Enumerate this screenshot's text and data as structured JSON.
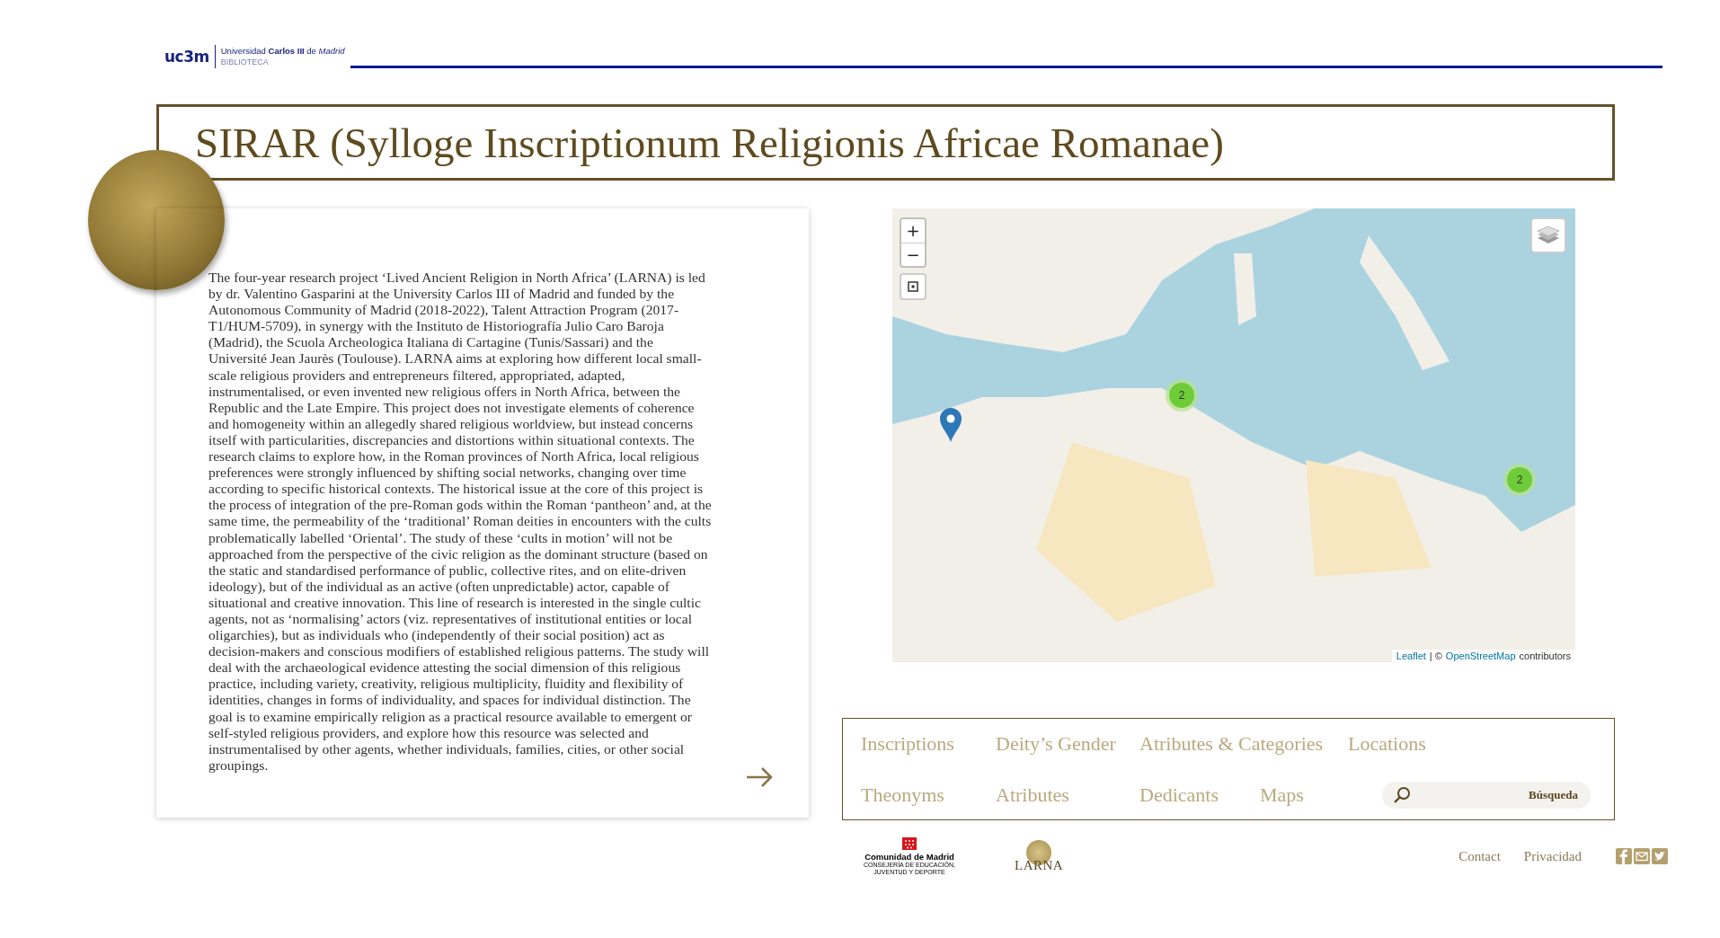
{
  "header": {
    "logo": {
      "wordmark": "uc3m",
      "university": "Universidad **Carlos III** de *Madrid*",
      "unit": "BIBLIOTECA"
    }
  },
  "title": "SIRAR (Sylloge Inscriptionum Religionis Africae Romanae)",
  "intro": {
    "text": "The four-year research project ‘Lived Ancient Religion in North Africa’ (LARNA) is led by dr. Valentino Gasparini at the University Carlos III of Madrid and funded by the Autonomous Community of Madrid (2018-2022), Talent Attraction Program (2017-T1/HUM-5709), in synergy with the Instituto de Historiografía Julio Caro Baroja (Madrid), the Scuola Archeologica Italiana di Cartagine (Tunis/Sassari) and the Université Jean Jaurès (Toulouse). LARNA aims at exploring how different local small-scale religious providers and entrepreneurs filtered, appropriated, adapted, instrumentalised, or even invented new religious offers in North Africa, between the Republic and the Late Empire. This project does not investigate elements of coherence and homogeneity within an allegedly shared religious worldview, but instead concerns itself with particularities, discrepancies and distortions within situational contexts. The research claims to explore how, in the Roman provinces of North Africa, local religious preferences were strongly influenced by shifting social networks, changing over time according to specific historical contexts. The historical issue at the core of this project is the process of integration of the pre-Roman gods within the Roman ‘pantheon’ and, at the same time, the permeability of the ‘traditional’ Roman deities in encounters with the cults problematically labelled ‘Oriental’. The study of these ‘cults in motion’ will not be approached from the perspective of the civic religion as the dominant structure (based on the static and standardised performance of public, collective rites, and on elite-driven ideology), but of the individual as an active (often unpredictable) actor, capable of situational and creative innovation. This line of research is interested in the single cultic agents, not as ‘normalising’ actors (viz. representatives of institutional entities or local oligarchies), but as individuals who (independently of their social position) act as decision-makers and conscious modifiers of established religious patterns. The study will deal with the archaeological evidence attesting the social dimension of this religious practice, including variety, creativity, religious multiplicity, fluidity and flexibility of identities, changes in forms of individuality, and spaces for individual distinction. The goal is to examine empirically religion as a practical resource available to emergent or self-styled religious providers, and explore how this resource was selected and instrumentalised by other agents, whether individuals, families, cities, or other social groupings."
  },
  "map": {
    "zoom_in": "+",
    "zoom_out": "−",
    "clusters": [
      "2",
      "2"
    ],
    "attribution": {
      "library": "Leaflet",
      "separator": "| ©",
      "source": "OpenStreetMap",
      "suffix": "contributors"
    }
  },
  "nav": {
    "links": [
      "Inscriptions",
      "Deity’s Gender",
      "Atributes & Categories",
      "Locations",
      "Theonyms",
      "Atributes",
      "Dedicants",
      "Maps"
    ],
    "search": {
      "placeholder": "Búsqueda"
    }
  },
  "footer": {
    "sponsor": {
      "name": "Comunidad de Madrid",
      "department": "CONSEJERÍA DE EDUCACIÓN, JUVENTUD Y DEPORTE"
    },
    "project_logo": {
      "name": "LARNA"
    },
    "links": [
      "Contact",
      "Privacidad"
    ]
  }
}
